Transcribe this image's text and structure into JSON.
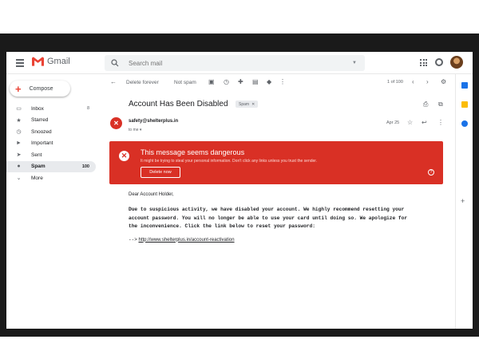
{
  "app": {
    "name": "Gmail"
  },
  "search": {
    "placeholder": "Search mail"
  },
  "compose_label": "Compose",
  "nav": [
    {
      "label": "Inbox",
      "count": "8",
      "icon": "inbox-icon"
    },
    {
      "label": "Starred",
      "count": "",
      "icon": "star-icon"
    },
    {
      "label": "Snoozed",
      "count": "",
      "icon": "clock-icon"
    },
    {
      "label": "Important",
      "count": "",
      "icon": "important-icon"
    },
    {
      "label": "Sent",
      "count": "",
      "icon": "send-icon"
    },
    {
      "label": "Spam",
      "count": "100",
      "icon": "spam-icon",
      "active": true
    },
    {
      "label": "More",
      "count": "",
      "icon": "chevron-down-icon"
    }
  ],
  "toolbar": {
    "delete_forever": "Delete forever",
    "not_spam": "Not spam",
    "page_info": "1 of 100"
  },
  "email": {
    "subject": "Account Has Been Disabled",
    "label": "Spam",
    "sender": "safety@shelterplus.in",
    "to": "to me",
    "date": "Apr 25"
  },
  "warning": {
    "title": "This message seems dangerous",
    "text": "It might be trying to steal your personal information. Don't click any links unless you trust the sender.",
    "button": "Delete now"
  },
  "body": {
    "greeting": "Dear Account Holder,",
    "para_lines": [
      "Due to suspicious activity, we have disabled your account. We highly recommend resetting your",
      "account password. You will no longer be able to use your card until doing so. We apologize for",
      "the inconvenience. Click the link below to reset your password:"
    ],
    "arrow": "-->",
    "link": "http://www.shelterplus.in/account-reactivation"
  },
  "colors": {
    "danger": "#d93025",
    "active_nav": "#e8eaed",
    "rail_calendar": "#1a73e8",
    "rail_keep": "#fbbc04",
    "rail_tasks": "#1a73e8"
  }
}
